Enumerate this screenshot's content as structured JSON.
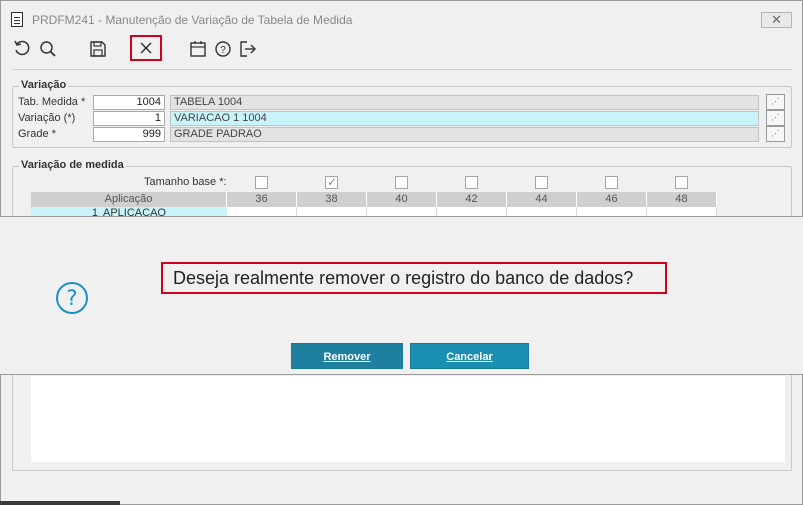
{
  "window": {
    "title": "PRDFM241 - Manutenção de Variação de Tabela de Medida",
    "close_label": "✕"
  },
  "toolbar": {
    "buttons": [
      {
        "name": "refresh-icon"
      },
      {
        "name": "search-icon"
      },
      {
        "name": "save-icon"
      },
      {
        "name": "delete-icon",
        "active": true
      },
      {
        "name": "calendar-icon"
      },
      {
        "name": "help-icon"
      },
      {
        "name": "exit-icon"
      }
    ]
  },
  "variacao": {
    "legend": "Variação",
    "fields": [
      {
        "label": "Tab. Medida *",
        "value": "1004",
        "description": "TABELA 1004",
        "highlighted": false
      },
      {
        "label": "Variação (*)",
        "value": "1",
        "description": "VARIACAO 1 1004",
        "highlighted": true
      },
      {
        "label": "Grade *",
        "value": "999",
        "description": "GRADE PADRAO",
        "highlighted": false
      }
    ],
    "lookup_glyph": "⋰"
  },
  "variacao_medida": {
    "legend": "Variação de medida",
    "tamanho_base_label": "Tamanho base *:",
    "sizes": [
      "36",
      "38",
      "40",
      "42",
      "44",
      "46",
      "48"
    ],
    "tamanho_base_checked": [
      false,
      true,
      false,
      false,
      false,
      false,
      false
    ],
    "aplicacao_header": "Aplicação",
    "rows": [
      {
        "number": "1",
        "aplicacao": "APLICACAO"
      }
    ]
  },
  "dialog": {
    "icon": "?",
    "message": "Deseja realmente remover o registro do banco de dados?",
    "confirm_label": "Remover",
    "cancel_label": "Cancelar"
  },
  "colors": {
    "accent": "#1a8fb2",
    "highlight": "#d0021b",
    "selected_field": "#c9f3fb"
  }
}
